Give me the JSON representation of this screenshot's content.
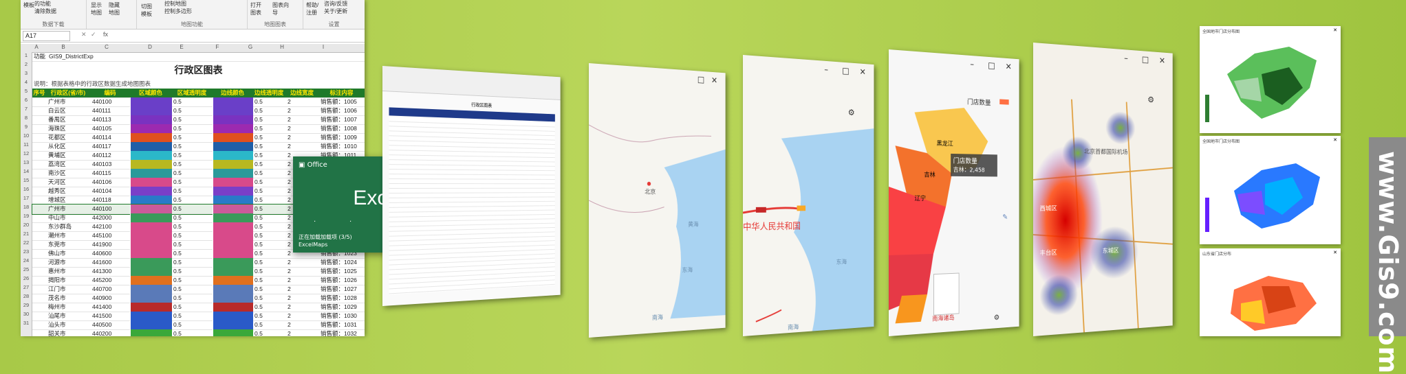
{
  "excel": {
    "ribbon": {
      "g1_items": [
        "模板",
        "数据下载"
      ],
      "g1_sub": [
        "的功能",
        "清除数据"
      ],
      "g2_items": [
        "显示",
        "隐藏",
        "地图",
        "地图"
      ],
      "g3_items": [
        "切图",
        "模板",
        "控制地图",
        "控制多边形"
      ],
      "g3_label": "地图功能",
      "g4_items": [
        "打开",
        "图表向",
        "图表",
        "导"
      ],
      "g4_label": "地图图表",
      "g5_items": [
        "帮助/",
        "注册",
        "咨询/反馈",
        "关于/更新"
      ],
      "g5_label": "设置"
    },
    "name_box": "A17",
    "fx_symbol": "fx",
    "col_letters": [
      "A",
      "B",
      "C",
      "D",
      "E",
      "F",
      "G",
      "H",
      "I"
    ],
    "row1_label": "功能",
    "row1_value": "GIS9_DistrictExp",
    "title": "行政区图表",
    "row3_note": "说明：根据表格中的行政区数据生成地图图表",
    "headers": [
      "序号",
      "行政区(省/市)",
      "编码",
      "区域颜色",
      "区域透明度",
      "边线颜色",
      "边线透明度",
      "边线宽度",
      "标注内容"
    ],
    "rows": [
      {
        "name": "广州市",
        "code": "440100",
        "color": "#6a3fc8",
        "op": "0.5",
        "w": "2",
        "label": "销售额：1005"
      },
      {
        "name": "白云区",
        "code": "440111",
        "color": "#6a3fc8",
        "op": "0.5",
        "w": "2",
        "label": "销售额：1006"
      },
      {
        "name": "番禺区",
        "code": "440113",
        "color": "#7a32c0",
        "op": "0.5",
        "w": "2",
        "label": "销售额：1007"
      },
      {
        "name": "海珠区",
        "code": "440105",
        "color": "#9c2ab0",
        "op": "0.5",
        "w": "2",
        "label": "销售额：1008"
      },
      {
        "name": "花都区",
        "code": "440114",
        "color": "#e0501e",
        "op": "0.5",
        "w": "2",
        "label": "销售额：1009"
      },
      {
        "name": "从化区",
        "code": "440117",
        "color": "#1f5fa8",
        "op": "0.5",
        "w": "2",
        "label": "销售额：1010"
      },
      {
        "name": "黄埔区",
        "code": "440112",
        "color": "#2bb8c9",
        "op": "0.5",
        "w": "2",
        "label": "销售额：1011"
      },
      {
        "name": "荔湾区",
        "code": "440103",
        "color": "#b8b820",
        "op": "0.5",
        "w": "2",
        "label": "销售额：1012"
      },
      {
        "name": "南沙区",
        "code": "440115",
        "color": "#2a9a9a",
        "op": "0.5",
        "w": "2",
        "label": "销售额：1013"
      },
      {
        "name": "天河区",
        "code": "440106",
        "color": "#d84a8a",
        "op": "0.5",
        "w": "2",
        "label": "销售额：1014"
      },
      {
        "name": "越秀区",
        "code": "440104",
        "color": "#7a3fc8",
        "op": "0.5",
        "w": "2",
        "label": "销售额：1015"
      },
      {
        "name": "增城区",
        "code": "440118",
        "color": "#2a7ac8",
        "op": "0.5",
        "w": "2",
        "label": "销售额：1016"
      },
      {
        "name": "广州市",
        "code": "440100",
        "color": "#cc5a9a",
        "op": "0.5",
        "w": "2",
        "label": "销售额：1017"
      },
      {
        "name": "中山市",
        "code": "442000",
        "color": "#3a9a5a",
        "op": "0.5",
        "w": "2",
        "label": "销售额：1018"
      },
      {
        "name": "东沙群岛",
        "code": "442100",
        "color": "#d84a8a",
        "op": "0.5",
        "w": "2",
        "label": "销售额：1019"
      },
      {
        "name": "潮州市",
        "code": "445100",
        "color": "#d84a8a",
        "op": "0.5",
        "w": "2",
        "label": "销售额：1020"
      },
      {
        "name": "东莞市",
        "code": "441900",
        "color": "#d84a8a",
        "op": "0.5",
        "w": "2",
        "label": "销售额：1021"
      },
      {
        "name": "佛山市",
        "code": "440600",
        "color": "#d84a8a",
        "op": "0.5",
        "w": "2",
        "label": "销售额：1023"
      },
      {
        "name": "河源市",
        "code": "441600",
        "color": "#3a9a5a",
        "op": "0.5",
        "w": "2",
        "label": "销售额：1024"
      },
      {
        "name": "惠州市",
        "code": "441300",
        "color": "#3a9a5a",
        "op": "0.5",
        "w": "2",
        "label": "销售额：1025"
      },
      {
        "name": "揭阳市",
        "code": "445200",
        "color": "#e0701e",
        "op": "0.5",
        "w": "2",
        "label": "销售额：1026"
      },
      {
        "name": "江门市",
        "code": "440700",
        "color": "#5a7ab8",
        "op": "0.5",
        "w": "2",
        "label": "销售额：1027"
      },
      {
        "name": "茂名市",
        "code": "440900",
        "color": "#5a7ab8",
        "op": "0.5",
        "w": "2",
        "label": "销售额：1028"
      },
      {
        "name": "梅州市",
        "code": "441400",
        "color": "#b82a2a",
        "op": "0.5",
        "w": "2",
        "label": "销售额：1029"
      },
      {
        "name": "汕尾市",
        "code": "441500",
        "color": "#2a5ac8",
        "op": "0.5",
        "w": "2",
        "label": "销售额：1030"
      },
      {
        "name": "汕头市",
        "code": "440500",
        "color": "#2a5ac8",
        "op": "0.5",
        "w": "2",
        "label": "销售额：1031"
      },
      {
        "name": "韶关市",
        "code": "440200",
        "color": "#3aa83a",
        "op": "0.5",
        "w": "2",
        "label": "销售额：1032"
      }
    ]
  },
  "splash": {
    "brand": "Office",
    "app": "Excel",
    "loading": "正在加载加载项 (3/5)",
    "addin": "ExcelMaps"
  },
  "panels": {
    "map1_labels": [
      "北京",
      "黄海",
      "东海",
      "南海"
    ],
    "map2_labels": [
      "中华人民共和国",
      "东海",
      "南海"
    ],
    "map3_title": "门店数量",
    "map3_tooltip_title": "门店数量",
    "map3_tooltip_value": "吉林：2,458",
    "map3_labels": [
      "黑龙江",
      "吉林",
      "辽宁",
      "南海诸岛"
    ],
    "map4_labels": [
      "北京首都国际机场",
      "西城区",
      "东城区",
      "丰台区"
    ]
  },
  "thumbs": {
    "t1": "全国地市门店分布图",
    "t2": "全国地市门店分布图",
    "t3": "山东省门店分布"
  },
  "site": "www.Gis9.com",
  "colors": {
    "accent_green": "#1f7a2a",
    "header_text": "#ffe600",
    "splash": "#217346"
  }
}
